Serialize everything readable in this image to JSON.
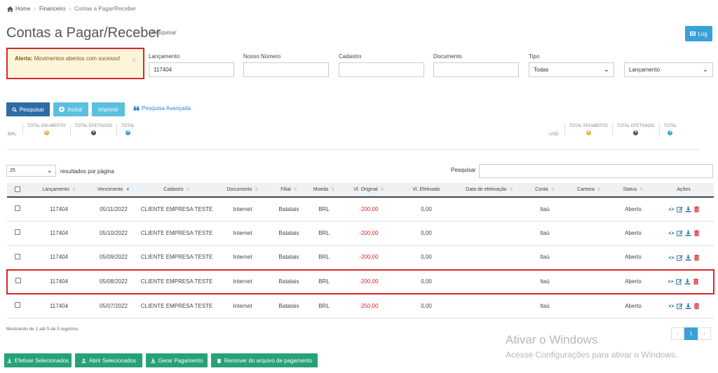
{
  "breadcrumb": {
    "home": "Home",
    "level1": "Financeiro",
    "current": "Contas a Pagar/Receber"
  },
  "header": {
    "title": "Contas a Pagar/Receber",
    "subtitle": "Pesquisar",
    "log_label": "Log"
  },
  "alert": {
    "strong": "Alerta:",
    "message": "Movimentos abertos com sucesso!",
    "close": "×"
  },
  "filters": {
    "lancamento": {
      "label": "Lançamento",
      "value": "117404"
    },
    "nosso_numero": {
      "label": "Nosso Número",
      "value": ""
    },
    "cadastro": {
      "label": "Cadastro",
      "value": ""
    },
    "documento": {
      "label": "Documento",
      "value": ""
    },
    "tipo": {
      "label": "Tipo",
      "value": "Todas"
    },
    "ordem": {
      "value": "Lançamento"
    }
  },
  "toolbar": {
    "pesquisar": "Pesquisar",
    "incluir": "Incluir",
    "imprimir": "Imprimir",
    "avancada": "Pesquisa Avançada"
  },
  "totals_brl": {
    "currency": "BRL",
    "aberto": "TOTAL EM ABERTO",
    "efetivado": "TOTAL EFETIVADO",
    "total": "TOTAL"
  },
  "totals_usd": {
    "currency": "USD",
    "aberto": "TOTAL EM ABERTO",
    "efetivado": "TOTAL EFETIVADO",
    "total": "TOTAL"
  },
  "table_controls": {
    "per_page": "25",
    "per_page_label": "resultados por página",
    "search_label": "Pesquisar"
  },
  "table": {
    "headers": [
      "Lançamento",
      "Vencimento",
      "Cadastro",
      "Documento",
      "Filial",
      "Moeda",
      "Vl. Original",
      "Vl. Efetivado",
      "Data de efetivação",
      "Conta",
      "Carteira",
      "Status",
      "Ações"
    ],
    "rows": [
      {
        "lancamento": "117404",
        "vencimento": "05/11/2022",
        "cadastro": "CLIENTE EMPRESA TESTE",
        "documento": "Internet",
        "filial": "Batatais",
        "moeda": "BRL",
        "original": "-200,00",
        "efetivado": "0,00",
        "data": "",
        "conta": "Itaú",
        "carteira": "",
        "status": "Aberto"
      },
      {
        "lancamento": "117404",
        "vencimento": "05/10/2022",
        "cadastro": "CLIENTE EMPRESA TESTE",
        "documento": "Internet",
        "filial": "Batatais",
        "moeda": "BRL",
        "original": "-200,00",
        "efetivado": "0,00",
        "data": "",
        "conta": "Itaú",
        "carteira": "",
        "status": "Aberto"
      },
      {
        "lancamento": "117404",
        "vencimento": "05/09/2022",
        "cadastro": "CLIENTE EMPRESA TESTE",
        "documento": "Internet",
        "filial": "Batatais",
        "moeda": "BRL",
        "original": "-200,00",
        "efetivado": "0,00",
        "data": "",
        "conta": "Itaú",
        "carteira": "",
        "status": "Aberto"
      },
      {
        "lancamento": "117404",
        "vencimento": "05/08/2022",
        "cadastro": "CLIENTE EMPRESA TESTE",
        "documento": "Internet",
        "filial": "Batatais",
        "moeda": "BRL",
        "original": "-200,00",
        "efetivado": "0,00",
        "data": "",
        "conta": "Itaú",
        "carteira": "",
        "status": "Aberto"
      },
      {
        "lancamento": "117404",
        "vencimento": "05/07/2022",
        "cadastro": "CLIENTE EMPRESA TESTE",
        "documento": "Internet",
        "filial": "Batatais",
        "moeda": "BRL",
        "original": "-250,00",
        "efetivado": "0,00",
        "data": "",
        "conta": "Itaú",
        "carteira": "",
        "status": "Aberto"
      }
    ]
  },
  "footer": {
    "showing": "Mostrando de 1 até 5 de 5 registros",
    "page_prev": "‹",
    "page_current": "1",
    "page_next": "›",
    "bulk": [
      "Efetivar Selecionados",
      "Abrir Selecionados",
      "Gerar Pagamento",
      "Remover do arquivo de pagamento"
    ]
  },
  "watermark": {
    "title": "Ativar o Windows",
    "subtitle": "Acesse Configurações para ativar o Windows."
  },
  "colors": {
    "primary": "#2e6da4",
    "info": "#5bc0de",
    "success": "#27a178",
    "danger": "#d9262b",
    "warning": "#f0ad4e"
  },
  "icons": {
    "home": "home-icon",
    "view": "eye-icon",
    "edit": "edit-icon",
    "download": "download-icon",
    "delete": "trash-icon"
  }
}
